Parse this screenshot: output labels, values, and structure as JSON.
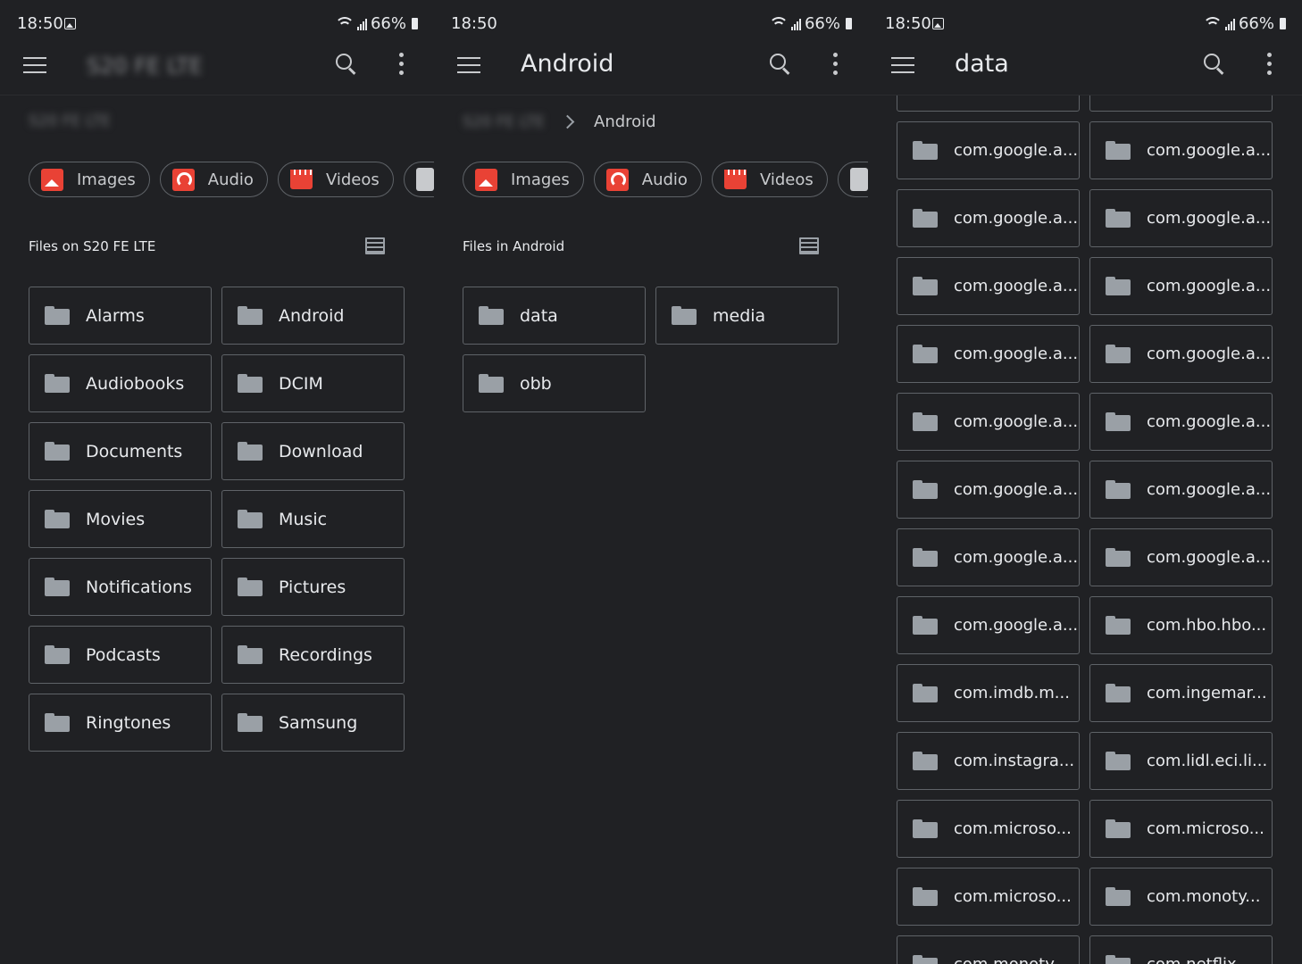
{
  "panels": [
    {
      "status": {
        "time": "18:50",
        "battery": "66%"
      },
      "title": "S20 FE LTE",
      "breadcrumb": [
        "S20 FE LTE"
      ],
      "chips": [
        "Images",
        "Audio",
        "Videos"
      ],
      "section_title": "Files on S20 FE LTE",
      "folders": [
        "Alarms",
        "Android",
        "Audiobooks",
        "DCIM",
        "Documents",
        "Download",
        "Movies",
        "Music",
        "Notifications",
        "Pictures",
        "Podcasts",
        "Recordings",
        "Ringtones",
        "Samsung"
      ]
    },
    {
      "status": {
        "time": "18:50",
        "battery": "66%"
      },
      "title": "Android",
      "breadcrumb": [
        "S20 FE LTE",
        "Android"
      ],
      "chips": [
        "Images",
        "Audio",
        "Videos"
      ],
      "section_title": "Files in Android",
      "folders": [
        "data",
        "media",
        "obb"
      ]
    },
    {
      "status": {
        "time": "18:50",
        "battery": "66%"
      },
      "title": "data",
      "folders": [
        "",
        "",
        "com.google.a...",
        "com.google.a...",
        "com.google.a...",
        "com.google.a...",
        "com.google.a...",
        "com.google.a...",
        "com.google.a...",
        "com.google.a...",
        "com.google.a...",
        "com.google.a...",
        "com.google.a...",
        "com.google.a...",
        "com.google.a...",
        "com.google.a...",
        "com.google.a...",
        "com.hbo.hbo...",
        "com.imdb.m...",
        "com.ingemar...",
        "com.instagra...",
        "com.lidl.eci.li...",
        "com.microso...",
        "com.microso...",
        "com.microso...",
        "com.monoty...",
        "com.monoty...",
        "com.netflix..."
      ]
    }
  ],
  "icons": {
    "chip_icons": [
      "image-icon",
      "headphones-icon",
      "video-icon",
      "document-icon"
    ],
    "accent": "#e94235"
  }
}
